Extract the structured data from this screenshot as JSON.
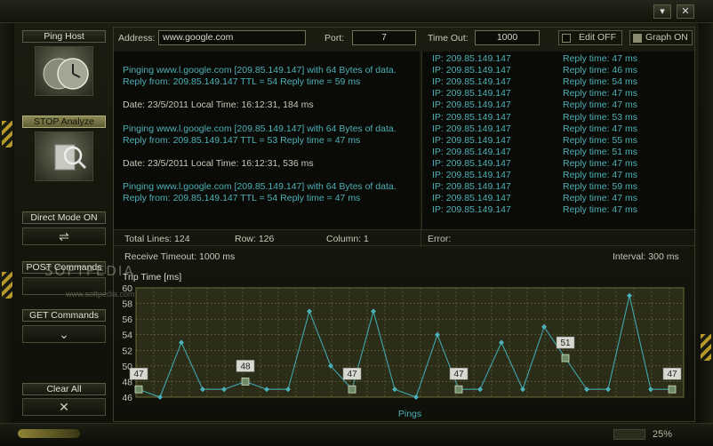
{
  "window": {
    "minimize_icon": "minimize-icon",
    "close_icon": "close-icon",
    "minimize_glyph": "▾",
    "close_glyph": "✕"
  },
  "sidebar": {
    "ping_host": "Ping Host",
    "stop_analyze": "STOP Analyze",
    "direct_mode": "Direct Mode ON",
    "post_commands": "POST Commands",
    "get_commands": "GET Commands",
    "clear_all": "Clear All"
  },
  "watermark": {
    "brand": "SOFTPEDIA",
    "url": "www.softpedia.com"
  },
  "toolbar": {
    "address_label": "Address:",
    "address_value": "www.google.com",
    "port_label": "Port:",
    "port_value": "7",
    "timeout_label": "Time Out:",
    "timeout_value": "1000",
    "edit_label": "Edit OFF",
    "graph_label": "Graph ON"
  },
  "log": [
    {
      "text": "Pinging www.l.google.com [209.85.149.147]  with 64 Bytes of data.",
      "color": "cyan"
    },
    {
      "text": "Reply from: 209.85.149.147  TTL = 54  Reply time = 59 ms",
      "color": "cyan"
    },
    {
      "text": "",
      "color": "white"
    },
    {
      "text": "Date: 23/5/2011 Local Time: 16:12:31, 184 ms",
      "color": "white"
    },
    {
      "text": "",
      "color": "white"
    },
    {
      "text": "Pinging www.l.google.com [209.85.149.147]  with 64 Bytes of data.",
      "color": "cyan"
    },
    {
      "text": "Reply from: 209.85.149.147  TTL = 53  Reply time = 47 ms",
      "color": "cyan"
    },
    {
      "text": "",
      "color": "white"
    },
    {
      "text": "Date: 23/5/2011 Local Time: 16:12:31, 536 ms",
      "color": "white"
    },
    {
      "text": "",
      "color": "white"
    },
    {
      "text": "Pinging www.l.google.com [209.85.149.147]  with 64 Bytes of data.",
      "color": "cyan"
    },
    {
      "text": "Reply from: 209.85.149.147  TTL = 54  Reply time = 47 ms",
      "color": "cyan"
    }
  ],
  "replies": [
    {
      "ip": "IP: 209.85.149.147",
      "time": "Reply time: 47 ms"
    },
    {
      "ip": "IP: 209.85.149.147",
      "time": "Reply time: 46 ms"
    },
    {
      "ip": "IP: 209.85.149.147",
      "time": "Reply time: 54 ms"
    },
    {
      "ip": "IP: 209.85.149.147",
      "time": "Reply time: 47 ms"
    },
    {
      "ip": "IP: 209.85.149.147",
      "time": "Reply time: 47 ms"
    },
    {
      "ip": "IP: 209.85.149.147",
      "time": "Reply time: 53 ms"
    },
    {
      "ip": "IP: 209.85.149.147",
      "time": "Reply time: 47 ms"
    },
    {
      "ip": "IP: 209.85.149.147",
      "time": "Reply time: 55 ms"
    },
    {
      "ip": "IP: 209.85.149.147",
      "time": "Reply time: 51 ms"
    },
    {
      "ip": "IP: 209.85.149.147",
      "time": "Reply time: 47 ms"
    },
    {
      "ip": "IP: 209.85.149.147",
      "time": "Reply time: 47 ms"
    },
    {
      "ip": "IP: 209.85.149.147",
      "time": "Reply time: 59 ms"
    },
    {
      "ip": "IP: 209.85.149.147",
      "time": "Reply time: 47 ms"
    },
    {
      "ip": "IP: 209.85.149.147",
      "time": "Reply time: 47 ms"
    }
  ],
  "status": {
    "total_lines": "Total Lines: 124",
    "row": "Row: 126",
    "column": "Column: 1",
    "error": "Error:"
  },
  "graph_info": {
    "receive_timeout": "Receive Timeout: 1000 ms",
    "interval": "Interval: 300 ms"
  },
  "footer": {
    "zoom": "25%"
  },
  "colors": {
    "line": "#3fa6ad",
    "point": "#4cb0b8",
    "grid": "#6b6c3a",
    "plot_bg": "#2c2d19",
    "stripes": "#b59a2a"
  },
  "chart_data": {
    "type": "line",
    "ylabel": "Trip Time [ms]",
    "xlabel": "Pings",
    "ylim": [
      46,
      60
    ],
    "yticks": [
      46,
      48,
      50,
      52,
      54,
      56,
      58,
      60
    ],
    "grid": true,
    "values": [
      47,
      46,
      53,
      47,
      47,
      48,
      47,
      47,
      57,
      50,
      47,
      57,
      47,
      46,
      54,
      47,
      47,
      53,
      47,
      55,
      51,
      47,
      47,
      59,
      47,
      47
    ],
    "markers": [
      {
        "index": 0,
        "label": "47"
      },
      {
        "index": 5,
        "label": "48"
      },
      {
        "index": 10,
        "label": "47"
      },
      {
        "index": 15,
        "label": "47"
      },
      {
        "index": 20,
        "label": "51"
      },
      {
        "index": 25,
        "label": "47"
      }
    ]
  }
}
